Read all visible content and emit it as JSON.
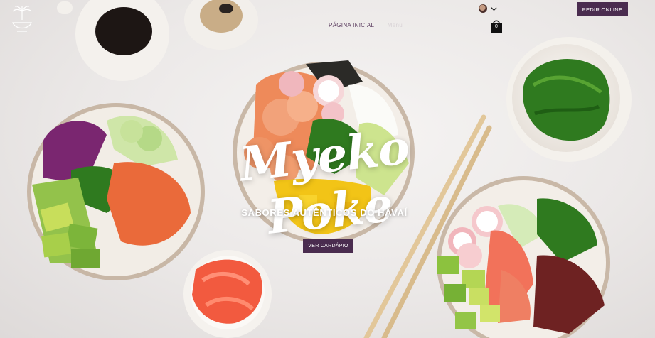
{
  "header": {
    "nav_items": [
      {
        "label": "PÁGINA INICIAL"
      },
      {
        "label": "Menu"
      }
    ],
    "cart_count": "0",
    "order_button": "PEDIR ONLINE"
  },
  "hero": {
    "brand_title": "Myeko Poke",
    "tagline": "SABORES AUTÊNTICOS DO HAVAÍ",
    "menu_button": "VER CARDÁPIO"
  },
  "colors": {
    "button_bg": "#4a2c4f",
    "nav_text": "#5a3b5e",
    "background": "#ece9e8"
  },
  "icons": [
    "palm-logo-icon",
    "avatar",
    "chevron-down-icon",
    "shopping-bag-icon"
  ]
}
